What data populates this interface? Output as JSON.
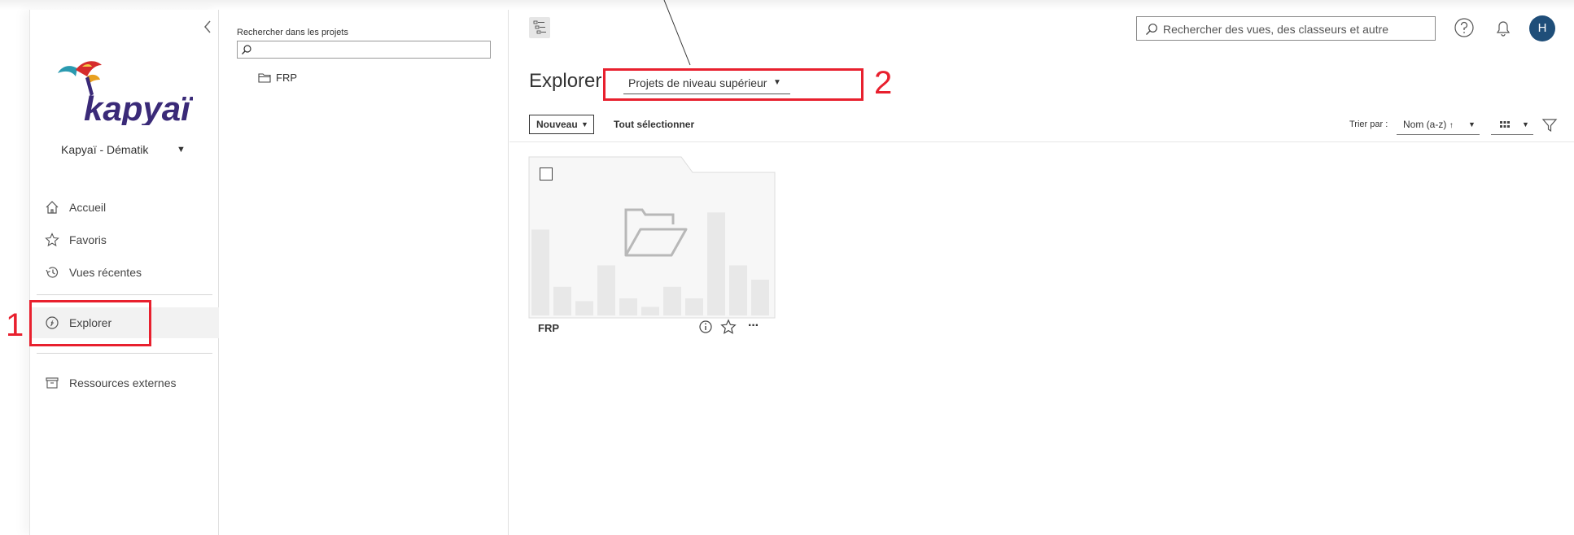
{
  "nav": {
    "collapse_icon": "chevron-left-icon",
    "logo_text": "kapyaï",
    "site_name": "Kapyaï - Dématik",
    "items": [
      {
        "label": "Accueil",
        "icon": "home-icon"
      },
      {
        "label": "Favoris",
        "icon": "star-icon"
      },
      {
        "label": "Vues récentes",
        "icon": "history-icon"
      },
      {
        "label": "Explorer",
        "icon": "compass-icon",
        "active": true
      },
      {
        "label": "Ressources externes",
        "icon": "box-icon"
      }
    ]
  },
  "tree": {
    "search_label": "Rechercher dans les projets",
    "search_value": "",
    "items": [
      {
        "label": "FRP",
        "icon": "folder-icon"
      }
    ]
  },
  "header": {
    "search_placeholder": "Rechercher des vues, des classeurs et autre",
    "avatar_initial": "H"
  },
  "main": {
    "title": "Explorer",
    "project_filter": "Projets de niveau supérieur",
    "new_button": "Nouveau",
    "select_all": "Tout sélectionner",
    "sort_label": "Trier par :",
    "sort_value": "Nom (a-z)",
    "cards": [
      {
        "name": "FRP",
        "type": "project",
        "bars": [
          0.6,
          0.2,
          0.1,
          0.35,
          0.12,
          0.06,
          0.2,
          0.12,
          0.72,
          0.35,
          0.25
        ]
      }
    ]
  },
  "annotations": {
    "callout_1": "1",
    "callout_2": "2",
    "color": "#e8202e"
  },
  "colors": {
    "avatar_bg": "#1f4e79",
    "logo_purple": "#3a2a78",
    "logo_teal": "#2a9ab0"
  }
}
